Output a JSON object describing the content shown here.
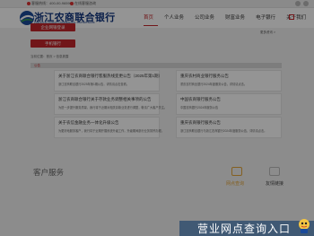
{
  "topbar": {
    "phone": "客服热线：400-00-96596",
    "online": "在线客服咨询"
  },
  "header": {
    "logo_text": "浙江农商联合银行",
    "logo_sub": "ZHEJIANG RURAL COMMERCIAL UNITED BANK",
    "nav": [
      "首页",
      "个人业务",
      "公司业务",
      "财富业务",
      "电子银行",
      "关于我们"
    ]
  },
  "buttons": {
    "top": "企业网银登录",
    "bottom": "手机银行"
  },
  "breadcrumb": "当前位置：首页 > 信息披露",
  "more_link": "更多资讯 >",
  "tabs": [
    "公告"
  ],
  "cards": [
    {
      "title": "关于浙江农商联合银行客服热线变更公告（2025年第1期）",
      "desc": "浙江农商联合银行2025年第1期公告，详情请点击查看。"
    },
    {
      "title": "重庆农村商业银行服务公告",
      "desc": "重庆农村商业银行2024年度服务公告，详情请点击。"
    },
    {
      "title": "浙江农商联合银行关于存款业务调整相关事项的公告",
      "desc": "为进一步提升服务质量，我行将于近期对相关存款业务进行调整，敬请广大客户关注。"
    },
    {
      "title": "中国农商银行服务公告",
      "desc": "中国农商银行2024年服务公告"
    },
    {
      "title": "关于农信金融业务一体化升级公告",
      "desc": "为更好地服务客户，我行将于近期开展系统升级工作，升级期间部分业务暂停办理。"
    },
    {
      "title": "重庆农商银行服务公告",
      "desc": "浙江农商联合银行与浙江农商银行2024年度服务公告，详情请点击。"
    }
  ],
  "service": {
    "title": "客户服务",
    "items": [
      "网点查询",
      "友情链接"
    ]
  },
  "banner": {
    "text": "营业网点查询入口"
  }
}
